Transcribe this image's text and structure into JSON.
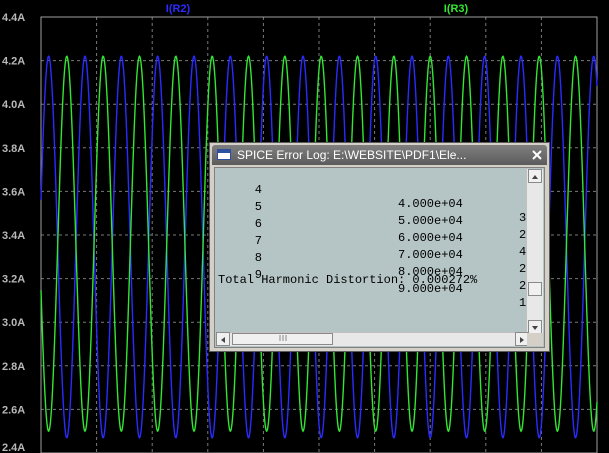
{
  "plot": {
    "y_axis_unit": "A",
    "y_ticks": [
      "4.4A",
      "4.2A",
      "4.0A",
      "3.8A",
      "3.6A",
      "3.4A",
      "3.2A",
      "3.0A",
      "2.8A",
      "2.6A",
      "2.4A"
    ],
    "background": "#000000",
    "grid_color": "#7a7a7a",
    "traces": [
      {
        "label": "I(R2)",
        "color": "#2b2bff"
      },
      {
        "label": "I(R3)",
        "color": "#33e633"
      }
    ]
  },
  "chart_data": {
    "type": "line",
    "title": "",
    "xlabel": "",
    "ylabel": "",
    "ylim": [
      2.4,
      4.4
    ],
    "grid": true,
    "series": [
      {
        "name": "I(R2)",
        "min": 2.47,
        "max": 4.22,
        "cycles_visible": 15.3
      },
      {
        "name": "I(R3)",
        "min": 2.5,
        "max": 4.22,
        "cycles_visible": 15.3
      }
    ]
  },
  "log_window": {
    "title": "SPICE Error Log: E:\\WEBSITE\\PDF1\\Ele...",
    "close_icon": "close-icon",
    "rows": [
      {
        "n": "4",
        "freq": "4.000e+04",
        "amp": "3"
      },
      {
        "n": "5",
        "freq": "5.000e+04",
        "amp": "2"
      },
      {
        "n": "6",
        "freq": "6.000e+04",
        "amp": "4"
      },
      {
        "n": "7",
        "freq": "7.000e+04",
        "amp": "2"
      },
      {
        "n": "8",
        "freq": "8.000e+04",
        "amp": "2"
      },
      {
        "n": "9",
        "freq": "9.000e+04",
        "amp": "1"
      }
    ],
    "thd_text": "Total Harmonic Distortion: 0.000272%"
  }
}
